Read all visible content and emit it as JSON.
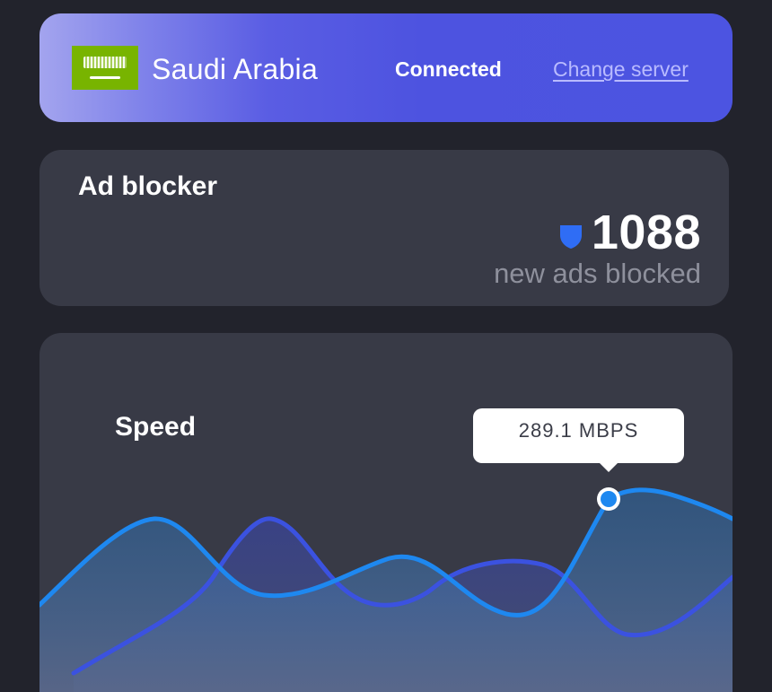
{
  "server": {
    "country": "Saudi Arabia",
    "flag_icon": "saudi-arabia-flag",
    "status": "Connected",
    "change_label": "Change server"
  },
  "ad_blocker": {
    "title": "Ad blocker",
    "icon": "shield-icon",
    "count": "1088",
    "caption": "new ads blocked"
  },
  "speed": {
    "title": "Speed",
    "tooltip": "289.1 MBPS"
  },
  "colors": {
    "accent": "#4c54e1",
    "line_primary": "#1e88f0",
    "line_secondary": "#3b52e0",
    "card": "#383a46",
    "background": "#22232c"
  }
}
